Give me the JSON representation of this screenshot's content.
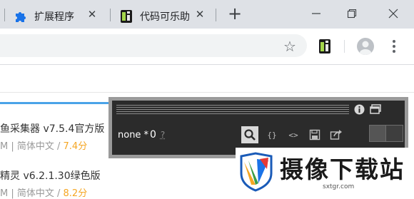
{
  "tabs": [
    {
      "label": "扩展程序",
      "icon": "puzzle-icon"
    },
    {
      "label": "代码可乐助",
      "icon": "extension-icon"
    }
  ],
  "toolbar": {
    "icons": [
      "bookmark-star-icon",
      "extension-icon",
      "profile-avatar-icon",
      "kebab-menu-icon"
    ]
  },
  "content": {
    "items": [
      {
        "title": "鱼采集器 v7.5.4官方版",
        "meta_prefix": "M | 简体中文 / ",
        "score": "7.4分"
      },
      {
        "title": "精灵 v6.2.1.30绿色版",
        "meta_prefix": "M | 简体中文 / ",
        "score": "8.2分"
      }
    ]
  },
  "overlay": {
    "value": "none",
    "star": "*",
    "count": "0",
    "help": "?",
    "tools": [
      "search-icon",
      "braces-icon",
      "angle-brackets-icon",
      "save-icon",
      "share-icon"
    ]
  },
  "watermark": {
    "text": "摄像下载站",
    "url": "sxtgr.com"
  },
  "colors": {
    "tabstrip": "#dee1e6",
    "accent_blue": "#4aa3e8",
    "score": "#f5a623",
    "overlay_bg": "#2b2b2b"
  }
}
